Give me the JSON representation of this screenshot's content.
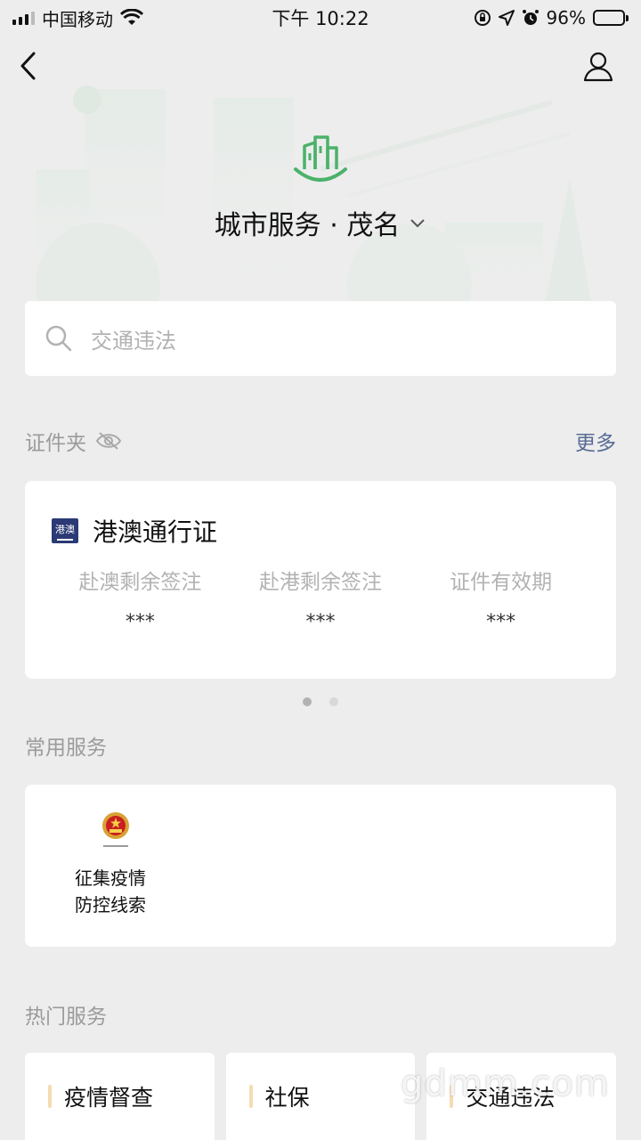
{
  "status_bar": {
    "carrier": "中国移动",
    "time": "下午 10:22",
    "battery_text": "96%",
    "battery_level": 0.96
  },
  "nav": {
    "back_icon": "chevron-left-icon",
    "profile_icon": "person-icon"
  },
  "header": {
    "city_icon": "city-building-icon",
    "title": "城市服务 · 茂名"
  },
  "search": {
    "placeholder": "交通违法"
  },
  "id_wallet": {
    "title": "证件夹",
    "more": "更多",
    "card": {
      "badge_text": "港澳",
      "name": "港澳通行证",
      "fields": [
        {
          "label": "赴澳剩余签注",
          "value": "***"
        },
        {
          "label": "赴港剩余签注",
          "value": "***"
        },
        {
          "label": "证件有效期",
          "value": "***"
        }
      ]
    },
    "pager": {
      "count": 2,
      "active": 0
    }
  },
  "common_services": {
    "title": "常用服务",
    "items": [
      {
        "label": "征集疫情\n防控线索",
        "icon": "national-emblem-icon"
      }
    ]
  },
  "hot_services": {
    "title": "热门服务",
    "items": [
      {
        "label": "疫情督查"
      },
      {
        "label": "社保"
      },
      {
        "label": "交通违法"
      }
    ]
  },
  "watermark": "gdmm.com",
  "colors": {
    "page_bg": "#ededed",
    "accent_green": "#4bb26a",
    "link_blue": "#576b95",
    "badge_navy": "#2b3a75",
    "tile_accent": "#f4dcb2"
  }
}
